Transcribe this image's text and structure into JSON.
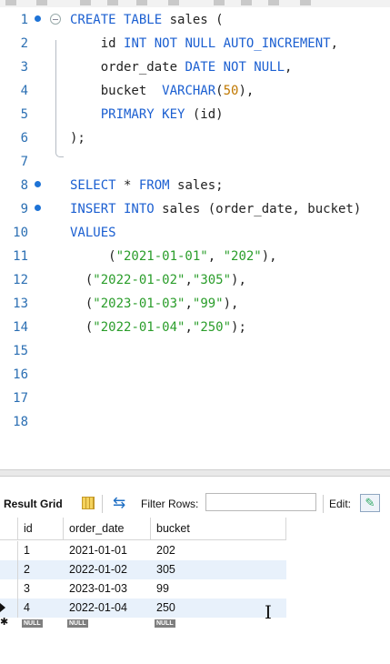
{
  "editor": {
    "lines": [
      {
        "n": "1",
        "dot": true,
        "fold": true,
        "parts": [
          [
            "kw",
            "CREATE TABLE"
          ],
          [
            "t",
            " sales ("
          ]
        ]
      },
      {
        "n": "2",
        "parts": [
          [
            "t",
            "    id "
          ],
          [
            "kw",
            "INT NOT NULL AUTO_INCREMENT"
          ],
          [
            "t",
            ","
          ]
        ]
      },
      {
        "n": "3",
        "parts": [
          [
            "t",
            "    order_date "
          ],
          [
            "kw",
            "DATE NOT NULL"
          ],
          [
            "t",
            ","
          ]
        ]
      },
      {
        "n": "4",
        "parts": [
          [
            "t",
            "    bucket  "
          ],
          [
            "kw",
            "VARCHAR"
          ],
          [
            "t",
            "("
          ],
          [
            "num",
            "50"
          ],
          [
            "t",
            "),"
          ]
        ]
      },
      {
        "n": "5",
        "parts": [
          [
            "t",
            "    "
          ],
          [
            "kw",
            "PRIMARY KEY"
          ],
          [
            "t",
            " (id)"
          ]
        ]
      },
      {
        "n": "6",
        "parts": [
          [
            "t",
            ");"
          ]
        ]
      },
      {
        "n": "7",
        "parts": []
      },
      {
        "n": "8",
        "dot": true,
        "parts": [
          [
            "kw",
            "SELECT"
          ],
          [
            "t",
            " * "
          ],
          [
            "kw",
            "FROM"
          ],
          [
            "t",
            " sales;"
          ]
        ]
      },
      {
        "n": "9",
        "dot": true,
        "parts": [
          [
            "kw",
            "INSERT INTO"
          ],
          [
            "t",
            " sales (order_date, bucket)"
          ]
        ]
      },
      {
        "n": "10",
        "parts": [
          [
            "kw",
            "VALUES"
          ]
        ]
      },
      {
        "n": "11",
        "parts": [
          [
            "t",
            "     ("
          ],
          [
            "str",
            "\"2021-01-01\""
          ],
          [
            "t",
            ", "
          ],
          [
            "str",
            "\"202\""
          ],
          [
            "t",
            "),"
          ]
        ]
      },
      {
        "n": "12",
        "parts": [
          [
            "t",
            "  ("
          ],
          [
            "str",
            "\"2022-01-02\""
          ],
          [
            "t",
            ","
          ],
          [
            "str",
            "\"305\""
          ],
          [
            "t",
            "),"
          ]
        ]
      },
      {
        "n": "13",
        "parts": [
          [
            "t",
            "  ("
          ],
          [
            "str",
            "\"2023-01-03\""
          ],
          [
            "t",
            ","
          ],
          [
            "str",
            "\"99\""
          ],
          [
            "t",
            "),"
          ]
        ]
      },
      {
        "n": "14",
        "parts": [
          [
            "t",
            "  ("
          ],
          [
            "str",
            "\"2022-01-04\""
          ],
          [
            "t",
            ","
          ],
          [
            "str",
            "\"250\""
          ],
          [
            "t",
            ");"
          ]
        ]
      },
      {
        "n": "15",
        "parts": []
      },
      {
        "n": "16",
        "parts": []
      },
      {
        "n": "17",
        "parts": []
      },
      {
        "n": "18",
        "parts": []
      }
    ]
  },
  "result_toolbar": {
    "result_grid_label": "Result Grid",
    "filter_label": "Filter Rows:",
    "filter_value": "",
    "edit_label": "Edit:",
    "icons": [
      "grid-icon",
      "refresh-icon",
      "edit-icon"
    ]
  },
  "grid": {
    "columns": [
      "id",
      "order_date",
      "bucket"
    ],
    "rows": [
      [
        "1",
        "2021-01-01",
        "202"
      ],
      [
        "2",
        "2022-01-02",
        "305"
      ],
      [
        "3",
        "2023-01-03",
        "99"
      ],
      [
        "4",
        "2022-01-04",
        "250"
      ]
    ],
    "null_label": "NULL"
  },
  "colors": {
    "keyword": "#1b5fd1",
    "string": "#2a9d2a",
    "number": "#c07800",
    "line_number": "#2b6fb3",
    "row_alt": "#e8f1fb"
  }
}
